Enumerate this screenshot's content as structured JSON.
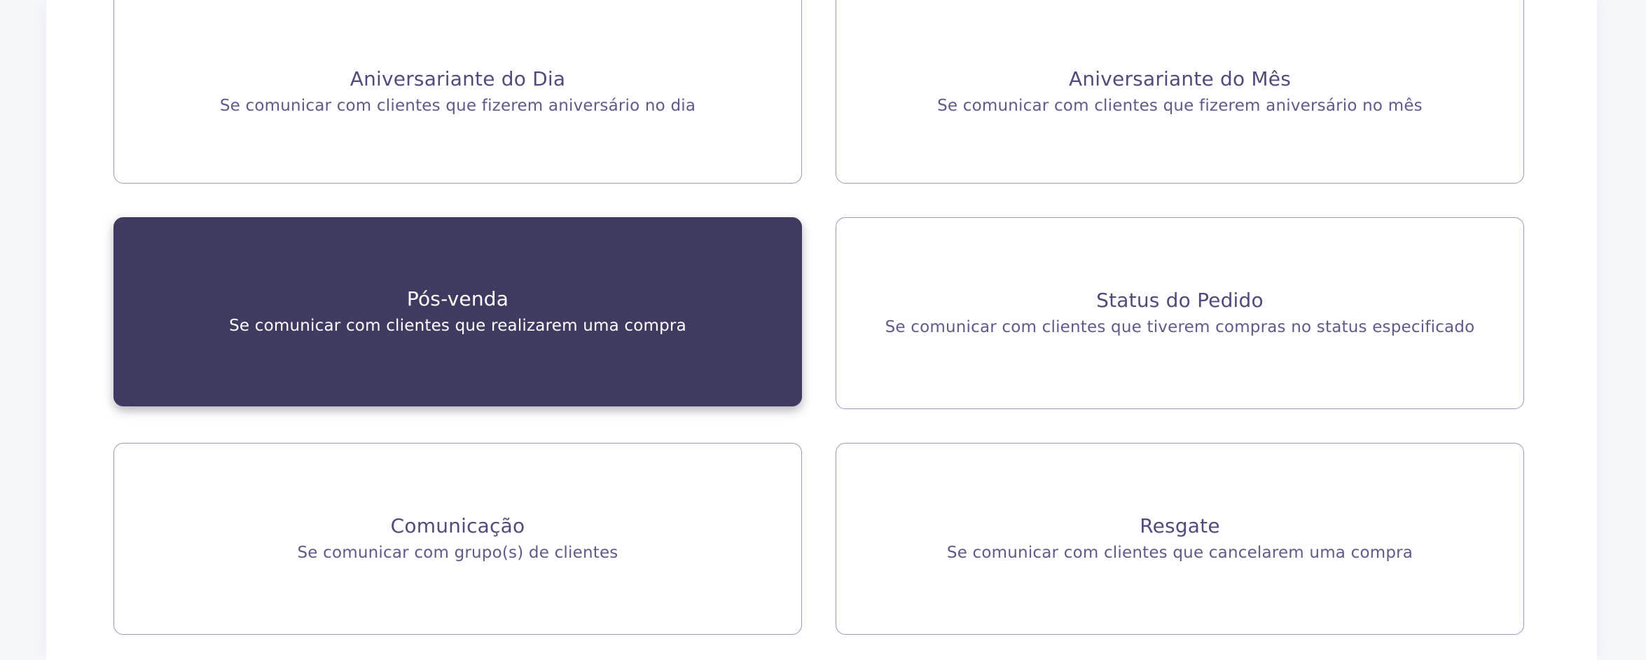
{
  "cards": [
    {
      "title": "Aniversariante do Dia",
      "description": "Se comunicar com clientes que fizerem aniversário no dia"
    },
    {
      "title": "Aniversariante do Mês",
      "description": "Se comunicar com clientes que fizerem aniversário no mês"
    },
    {
      "title": "Pós-venda",
      "description": "Se comunicar com clientes que realizarem uma compra"
    },
    {
      "title": "Status do Pedido",
      "description": "Se comunicar com clientes que tiverem compras no status especificado"
    },
    {
      "title": "Comunicação",
      "description": "Se comunicar com grupo(s) de clientes"
    },
    {
      "title": "Resgate",
      "description": "Se comunicar com clientes que cancelarem uma compra"
    }
  ],
  "colors": {
    "selected_background": "#3f3a60",
    "card_border": "#9a98bd",
    "text_primary": "#514b7c",
    "page_background": "#f6f7fb"
  }
}
